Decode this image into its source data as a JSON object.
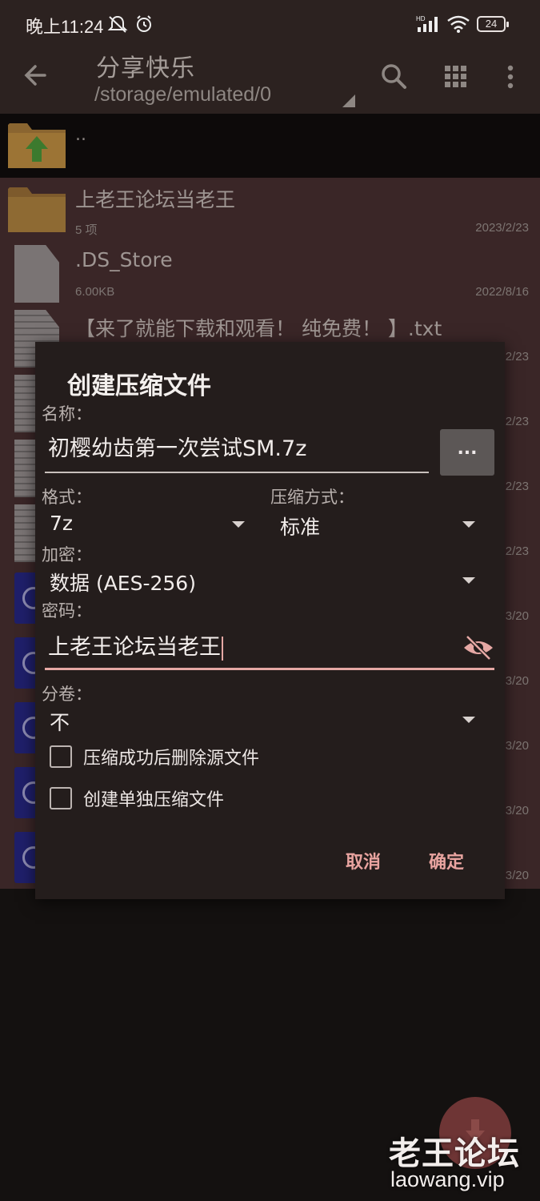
{
  "status_bar": {
    "time": "晚上11:24",
    "battery": "24",
    "icons": [
      "mute-icon",
      "alarm-icon",
      "hd-signal-icon",
      "wifi-icon",
      "battery-icon"
    ]
  },
  "appbar": {
    "title": "分享快乐",
    "path": "/storage/emulated/0"
  },
  "file_list": {
    "parent_label": "..",
    "items": [
      {
        "name": "上老王论坛当老王",
        "meta": "5 项",
        "date": "2023/2/23",
        "icon": "folder-icon"
      },
      {
        "name": ".DS_Store",
        "meta": "6.00KB",
        "date": "2022/8/16",
        "icon": "file-icon"
      },
      {
        "name": "【来了就能下载和观看！ 纯免费！ 】.txt",
        "meta": "",
        "date": "2/23",
        "icon": "text-file-icon"
      },
      {
        "name": "",
        "meta": "",
        "date": "2/23",
        "icon": "text-file-icon"
      },
      {
        "name": "",
        "meta": "",
        "date": "2/23",
        "icon": "text-file-icon"
      },
      {
        "name": "",
        "meta": "",
        "date": "2/23",
        "icon": "text-file-icon"
      },
      {
        "name": "",
        "meta": "",
        "date": "3/20",
        "icon": "archive-icon"
      },
      {
        "name": "",
        "meta": "",
        "date": "3/20",
        "icon": "archive-icon"
      },
      {
        "name": "",
        "meta": "",
        "date": "3/20",
        "icon": "archive-icon"
      },
      {
        "name": "",
        "meta": "",
        "date": "3/20",
        "icon": "archive-icon"
      },
      {
        "name": "",
        "meta": "",
        "date": "3/20",
        "icon": "archive-icon"
      }
    ]
  },
  "dialog": {
    "title": "创建压缩文件",
    "name_label": "名称：",
    "name_value": "初樱幼齿第一次尝试SM.7z",
    "browse_label": "...",
    "format_label": "格式：",
    "format_value": "7z",
    "method_label": "压缩方式：",
    "method_value": "标准",
    "encrypt_label": "加密：",
    "encrypt_value": "数据 (AES-256)",
    "password_label": "密码：",
    "password_value": "上老王论坛当老王",
    "split_label": "分卷：",
    "split_value": "不",
    "option_delete": "压缩成功后删除源文件",
    "option_separate": "创建单独压缩文件",
    "cancel": "取消",
    "ok": "确定"
  },
  "watermark": {
    "line1": "老王论坛",
    "line2": "laowang.vip"
  },
  "colors": {
    "accent": "#e9a4a0",
    "background": "#141110",
    "dialog": "#241d1c",
    "list_overlay": "#3a2627"
  }
}
